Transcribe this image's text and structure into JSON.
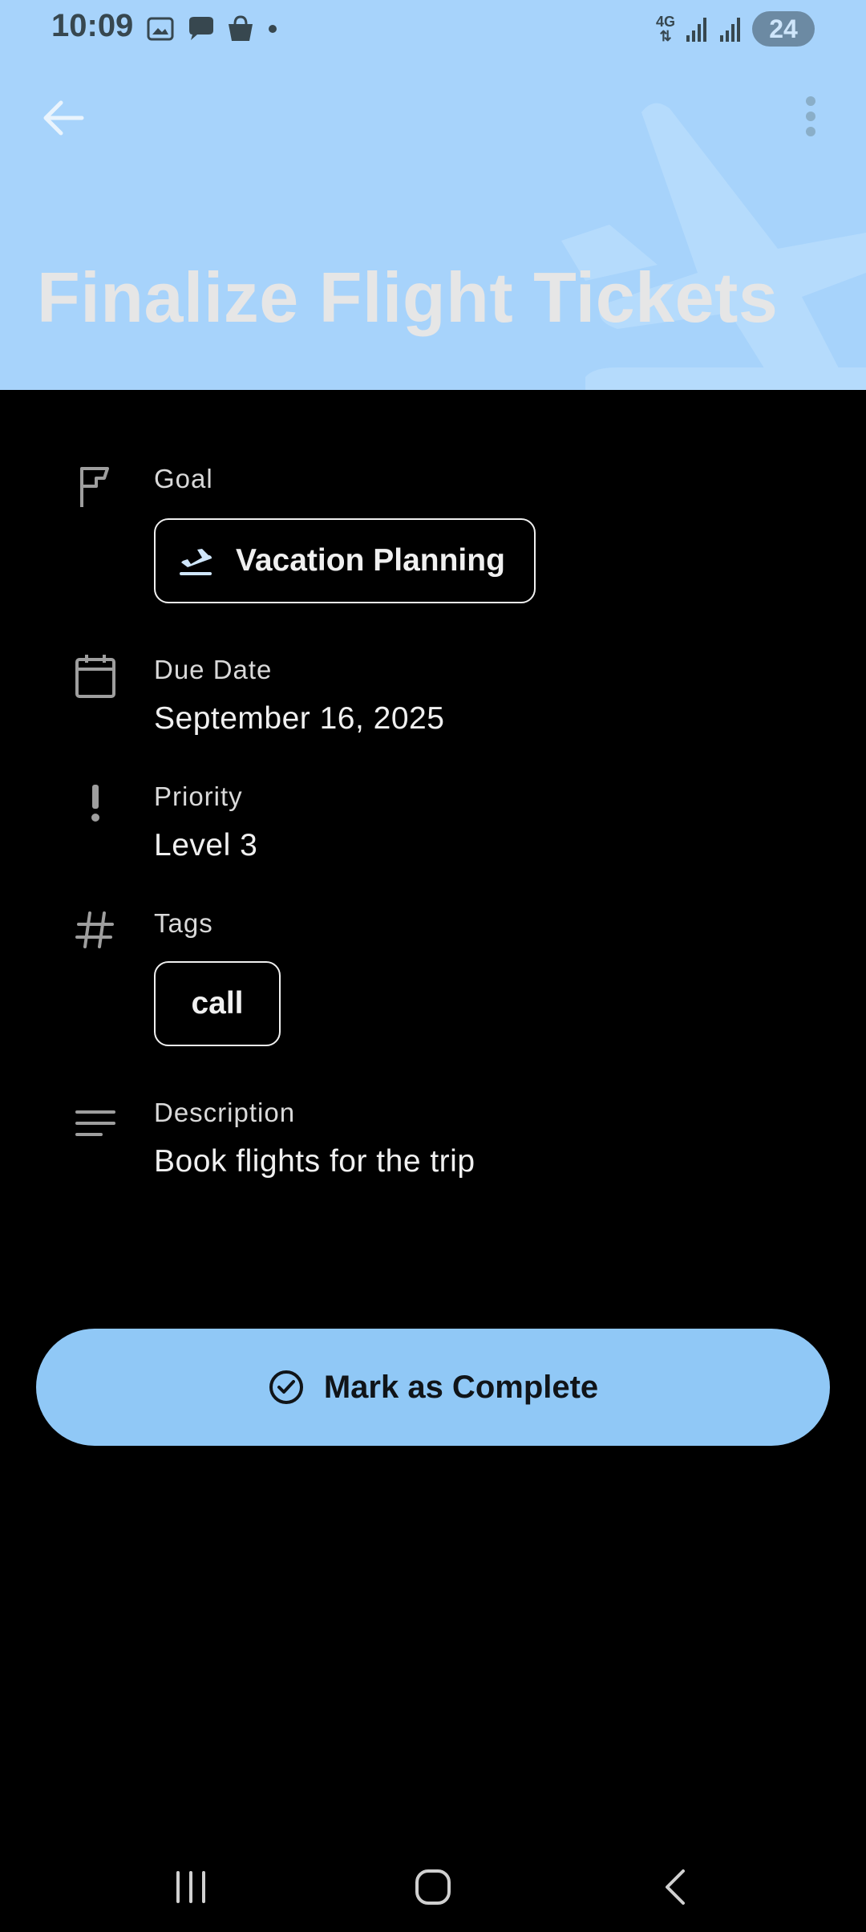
{
  "status_bar": {
    "time": "10:09",
    "network": "4G",
    "battery": "24",
    "left_icons": [
      "screenshot-icon",
      "chat-icon",
      "shopping-bag-icon",
      "dot-icon"
    ],
    "right_icons": [
      "data-arrows-icon",
      "signal-icon",
      "signal-icon",
      "battery-charging-icon"
    ]
  },
  "header": {
    "title": "Finalize Flight Tickets",
    "background_color": "#a7d3fb",
    "back_icon": "arrow-left-icon",
    "menu_icon": "more-vert-icon",
    "decoration_icon": "airplane-icon"
  },
  "details": {
    "goal": {
      "label": "Goal",
      "chip": "Vacation Planning",
      "icon": "flag-icon",
      "chip_icon": "flight-takeoff-icon"
    },
    "due_date": {
      "label": "Due Date",
      "value": "September 16, 2025",
      "icon": "calendar-icon"
    },
    "priority": {
      "label": "Priority",
      "value": "Level 3",
      "icon": "exclamation-icon"
    },
    "tags": {
      "label": "Tags",
      "items": [
        "call"
      ],
      "icon": "hash-icon"
    },
    "description": {
      "label": "Description",
      "value": "Book flights for the trip",
      "icon": "notes-icon"
    }
  },
  "actions": {
    "complete": {
      "label": "Mark as Complete",
      "icon": "check-circle-icon",
      "color": "#90c8f6"
    }
  },
  "nav_bar": {
    "items": [
      "recents-icon",
      "home-icon",
      "back-icon"
    ]
  }
}
